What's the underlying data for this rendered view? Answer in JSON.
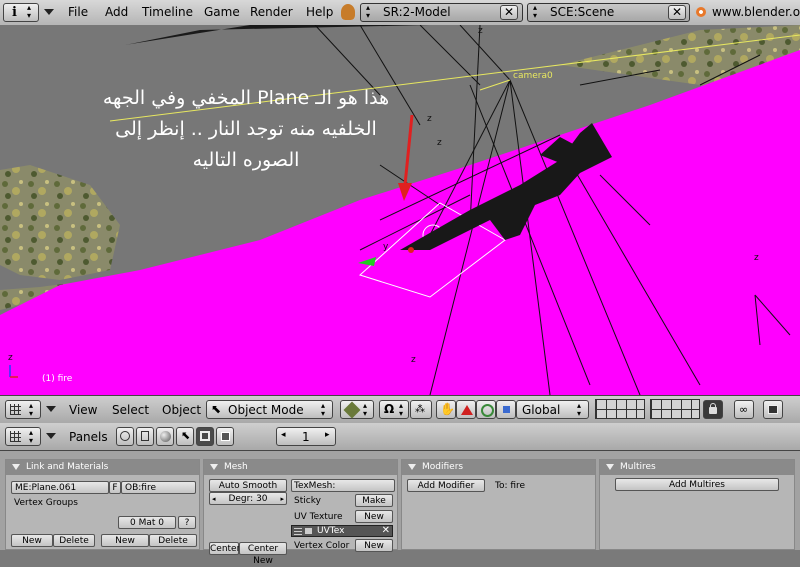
{
  "topbar": {
    "menu": [
      "File",
      "Add",
      "Timeline",
      "Game",
      "Render",
      "Help"
    ],
    "screen": "SR:2-Model",
    "scene": "SCE:Scene",
    "url": "www.blender.org"
  },
  "viewport": {
    "annotation_lines": [
      "هذا هو الـ Plane المخفي وفي الجهه",
      "الخلفيه منه توجد النار .. إنظر إلى",
      "الصوره التاليه"
    ],
    "camera_label": "camera0",
    "frame_label": "(1) fire",
    "colors": {
      "magenta": "#ff00ff",
      "yellow_line": "#e8e860",
      "red_arrow": "#e02020"
    }
  },
  "header3d": {
    "menu": [
      "View",
      "Select",
      "Object"
    ],
    "mode": "Object Mode",
    "orientation": "Global"
  },
  "buttons_header": {
    "panels_label": "Panels",
    "frame_number": "1"
  },
  "panels": {
    "link_materials": {
      "title": "Link and Materials",
      "mesh_name": "ME:Plane.061",
      "f_label": "F",
      "object_name": "OB:fire",
      "vertex_groups": "Vertex Groups",
      "mat_label": "0 Mat 0",
      "question": "?",
      "new1": "New",
      "delete1": "Delete",
      "new2": "New",
      "delete2": "Delete"
    },
    "mesh": {
      "title": "Mesh",
      "auto_smooth": "Auto Smooth",
      "degr": "Degr: 30",
      "texmesh": "TexMesh:",
      "sticky": "Sticky",
      "make": "Make",
      "uv_texture": "UV Texture",
      "new_uv": "New",
      "uvtex": "UVTex",
      "vertex_color": "Vertex Color",
      "new_vc": "New",
      "center": "Center",
      "center_new": "Center New"
    },
    "modifiers": {
      "title": "Modifiers",
      "add_modifier": "Add Modifier",
      "to": "To: fire"
    },
    "multires": {
      "title": "Multires",
      "add_multires": "Add Multires"
    }
  }
}
